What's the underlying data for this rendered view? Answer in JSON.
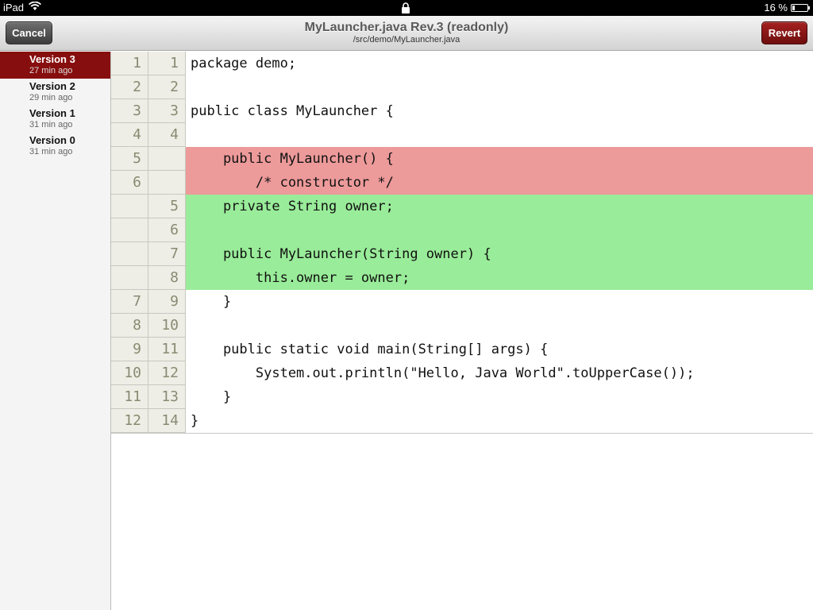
{
  "status_bar": {
    "device": "iPad",
    "wifi_icon": "wifi-icon",
    "lock_icon": "lock-icon",
    "battery_text": "16 %",
    "battery_level": 0.16
  },
  "nav": {
    "cancel_label": "Cancel",
    "revert_label": "Revert",
    "title": "MyLauncher.java Rev.3 (readonly)",
    "subtitle": "/src/demo/MyLauncher.java"
  },
  "versions": [
    {
      "name": "Version 3",
      "time": "27 min ago",
      "selected": true
    },
    {
      "name": "Version 2",
      "time": "29 min ago",
      "selected": false
    },
    {
      "name": "Version 1",
      "time": "31 min ago",
      "selected": false
    },
    {
      "name": "Version 0",
      "time": "31 min ago",
      "selected": false
    }
  ],
  "diff": {
    "colors": {
      "deleted": "#ed9a9a",
      "added": "#99ec99",
      "selected_version": "#870e0e"
    },
    "lines": [
      {
        "old": "1",
        "new": "1",
        "type": "same",
        "text": "package demo;"
      },
      {
        "old": "2",
        "new": "2",
        "type": "same",
        "text": ""
      },
      {
        "old": "3",
        "new": "3",
        "type": "same",
        "text": "public class MyLauncher {"
      },
      {
        "old": "4",
        "new": "4",
        "type": "same",
        "text": ""
      },
      {
        "old": "5",
        "new": "",
        "type": "del",
        "text": "    public MyLauncher() {"
      },
      {
        "old": "6",
        "new": "",
        "type": "del",
        "text": "        /* constructor */"
      },
      {
        "old": "",
        "new": "5",
        "type": "add",
        "text": "    private String owner;"
      },
      {
        "old": "",
        "new": "6",
        "type": "add",
        "text": ""
      },
      {
        "old": "",
        "new": "7",
        "type": "add",
        "text": "    public MyLauncher(String owner) {"
      },
      {
        "old": "",
        "new": "8",
        "type": "add",
        "text": "        this.owner = owner;"
      },
      {
        "old": "7",
        "new": "9",
        "type": "same",
        "text": "    }"
      },
      {
        "old": "8",
        "new": "10",
        "type": "same",
        "text": ""
      },
      {
        "old": "9",
        "new": "11",
        "type": "same",
        "text": "    public static void main(String[] args) {"
      },
      {
        "old": "10",
        "new": "12",
        "type": "same",
        "text": "        System.out.println(\"Hello, Java World\".toUpperCase());"
      },
      {
        "old": "11",
        "new": "13",
        "type": "same",
        "text": "    }"
      },
      {
        "old": "12",
        "new": "14",
        "type": "same",
        "text": "}"
      }
    ]
  }
}
